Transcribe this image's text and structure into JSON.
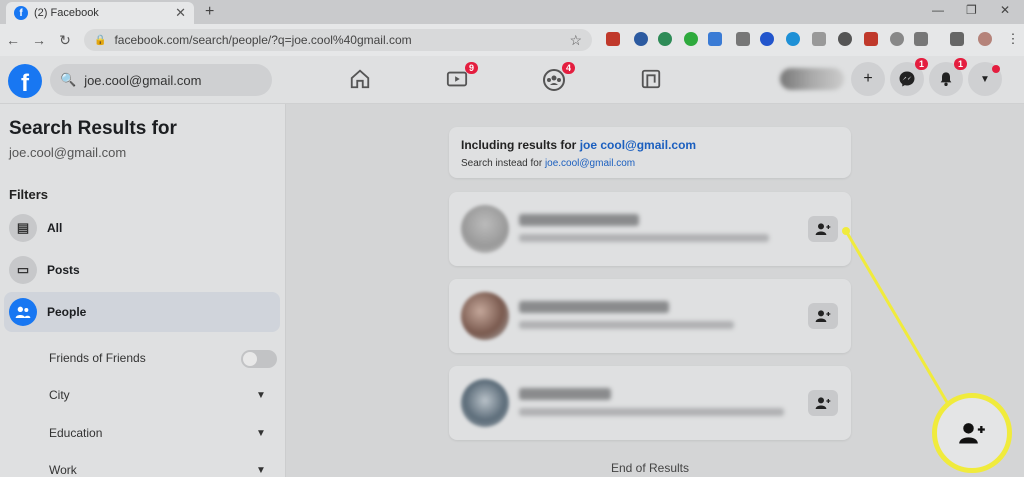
{
  "browser": {
    "tab_title": "(2) Facebook",
    "tab_favicon": "f",
    "url": "facebook.com/search/people/?q=joe.cool%40gmail.com"
  },
  "header": {
    "logo": "f",
    "search_value": "joe.cool@gmail.com",
    "watch_badge": "9",
    "groups_badge": "4",
    "messenger_badge": "1",
    "notifications_badge": "1"
  },
  "sidebar": {
    "title": "Search Results for",
    "query": "joe.cool@gmail.com",
    "filters_label": "Filters",
    "items": [
      {
        "label": "All",
        "icon": "feed-icon"
      },
      {
        "label": "Posts",
        "icon": "posts-icon"
      },
      {
        "label": "People",
        "icon": "people-icon"
      }
    ],
    "sub_filters": [
      "Friends of Friends",
      "City",
      "Education",
      "Work"
    ]
  },
  "results": {
    "including_prefix": "Including results for ",
    "including_query": "joe cool@gmail.com",
    "instead_prefix": "Search instead for ",
    "instead_query": "joe.cool@gmail.com",
    "end_label": "End of Results"
  },
  "colors": {
    "accent": "#1877f2",
    "badge": "#e41e3f",
    "highlight": "#f0eb3c"
  }
}
